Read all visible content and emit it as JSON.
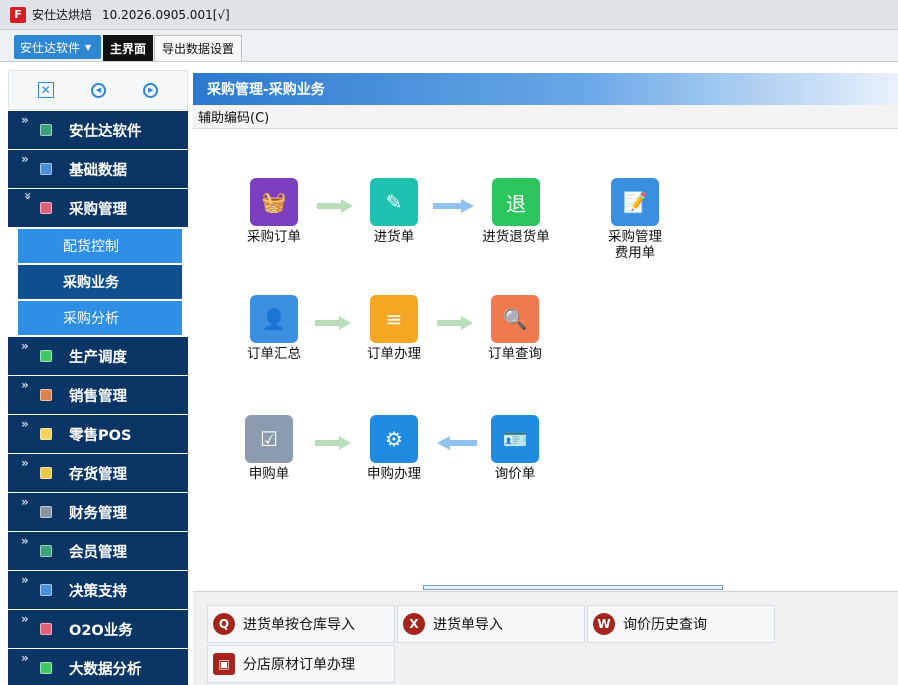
{
  "window": {
    "title": "安仕达烘焙",
    "version": "10.2026.0905.001[√]"
  },
  "toolbar": {
    "app_menu": "安仕达软件",
    "tabs": [
      {
        "label": "主界面"
      },
      {
        "label": "导出数据设置"
      }
    ]
  },
  "sidebar": {
    "items": [
      {
        "label": "安仕达软件",
        "color": "#3aa37a"
      },
      {
        "label": "基础数据",
        "color": "#4a8fd9"
      },
      {
        "label": "采购管理",
        "color": "#e0607a"
      },
      {
        "label": "生产调度",
        "color": "#42c469"
      },
      {
        "label": "销售管理",
        "color": "#d9844f"
      },
      {
        "label": "零售POS",
        "color": "#f2d35a"
      },
      {
        "label": "存货管理",
        "color": "#e9c74a"
      },
      {
        "label": "财务管理",
        "color": "#8b95a3"
      },
      {
        "label": "会员管理",
        "color": "#3aa37a"
      },
      {
        "label": "决策支持",
        "color": "#4a8fd9"
      },
      {
        "label": "O2O业务",
        "color": "#e0607a"
      },
      {
        "label": "大数据分析",
        "color": "#42c469"
      }
    ],
    "subitems": [
      {
        "label": "配货控制"
      },
      {
        "label": "采购业务"
      },
      {
        "label": "采购分析"
      }
    ]
  },
  "main": {
    "header": "采购管理-采购业务",
    "assist_label": "辅助编码(C)",
    "functions": [
      {
        "label": "采购订单",
        "icon": "basket-icon",
        "color": "#7b3fbf"
      },
      {
        "label": "进货单",
        "icon": "receipt-edit-icon",
        "color": "#1fc1b1"
      },
      {
        "label": "进货退货单",
        "icon": "return-icon",
        "color": "#2bc55e"
      },
      {
        "label": "采购管理费用单",
        "icon": "document-edit-icon",
        "color": "#3b8fe0"
      },
      {
        "label": "订单汇总",
        "icon": "user-list-icon",
        "color": "#3b8fe0"
      },
      {
        "label": "订单办理",
        "icon": "list-pen-icon",
        "color": "#f5a623"
      },
      {
        "label": "订单查询",
        "icon": "doc-search-icon",
        "color": "#ee7a4d"
      },
      {
        "label": "申购单",
        "icon": "form-check-icon",
        "color": "#8c9bb0"
      },
      {
        "label": "申购办理",
        "icon": "monitor-gear-icon",
        "color": "#1f8be0"
      },
      {
        "label": "询价单",
        "icon": "id-card-icon",
        "color": "#1f8be0"
      }
    ]
  },
  "quick": [
    {
      "label": "进货单按仓库导入",
      "icon": "search-icon"
    },
    {
      "label": "进货单导入",
      "icon": "excel-icon"
    },
    {
      "label": "询价历史查询",
      "icon": "document-icon"
    },
    {
      "label": "分店原材订单办理",
      "icon": "person-card-icon"
    }
  ]
}
